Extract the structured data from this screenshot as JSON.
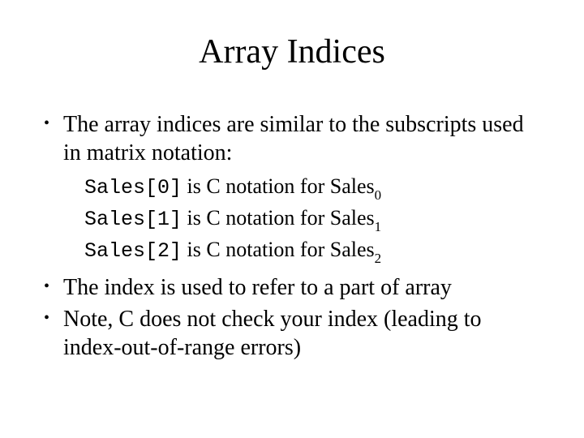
{
  "title": "Array Indices",
  "bullets": {
    "b1": "The array indices are similar to the subscripts used in matrix notation:",
    "b2": "The index is used to refer to a part of array",
    "b3": "Note, C does not check your index (leading to index-out-of-range errors)"
  },
  "examples": [
    {
      "code": "Sales[0]",
      "mid": " is C notation for Sales",
      "sub": "0"
    },
    {
      "code": "Sales[1]",
      "mid": " is C notation for Sales",
      "sub": "1"
    },
    {
      "code": "Sales[2]",
      "mid": " is C notation for Sales",
      "sub": "2"
    }
  ]
}
